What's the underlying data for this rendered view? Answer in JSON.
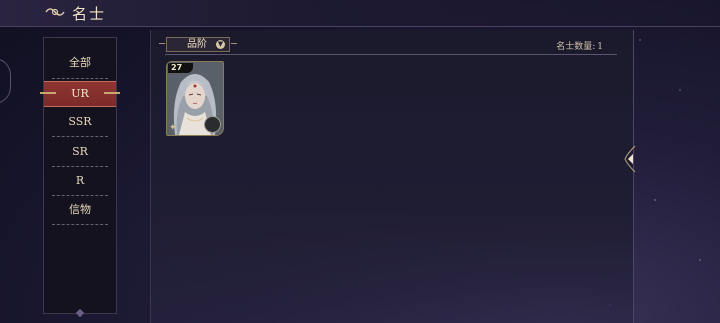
{
  "header": {
    "title": "名士"
  },
  "categories": [
    {
      "label": "全部",
      "active": false
    },
    {
      "label": "UR",
      "active": true
    },
    {
      "label": "SSR",
      "active": false
    },
    {
      "label": "SR",
      "active": false
    },
    {
      "label": "R",
      "active": false
    },
    {
      "label": "信物",
      "active": false
    }
  ],
  "filter": {
    "label": "品阶"
  },
  "count": {
    "label": "名士数量:",
    "value": "1"
  },
  "cards": [
    {
      "level": "27"
    }
  ],
  "colors": {
    "active_tab": "#8e3532",
    "accent_gold": "#c8a870",
    "background": "#1b1a2c"
  }
}
